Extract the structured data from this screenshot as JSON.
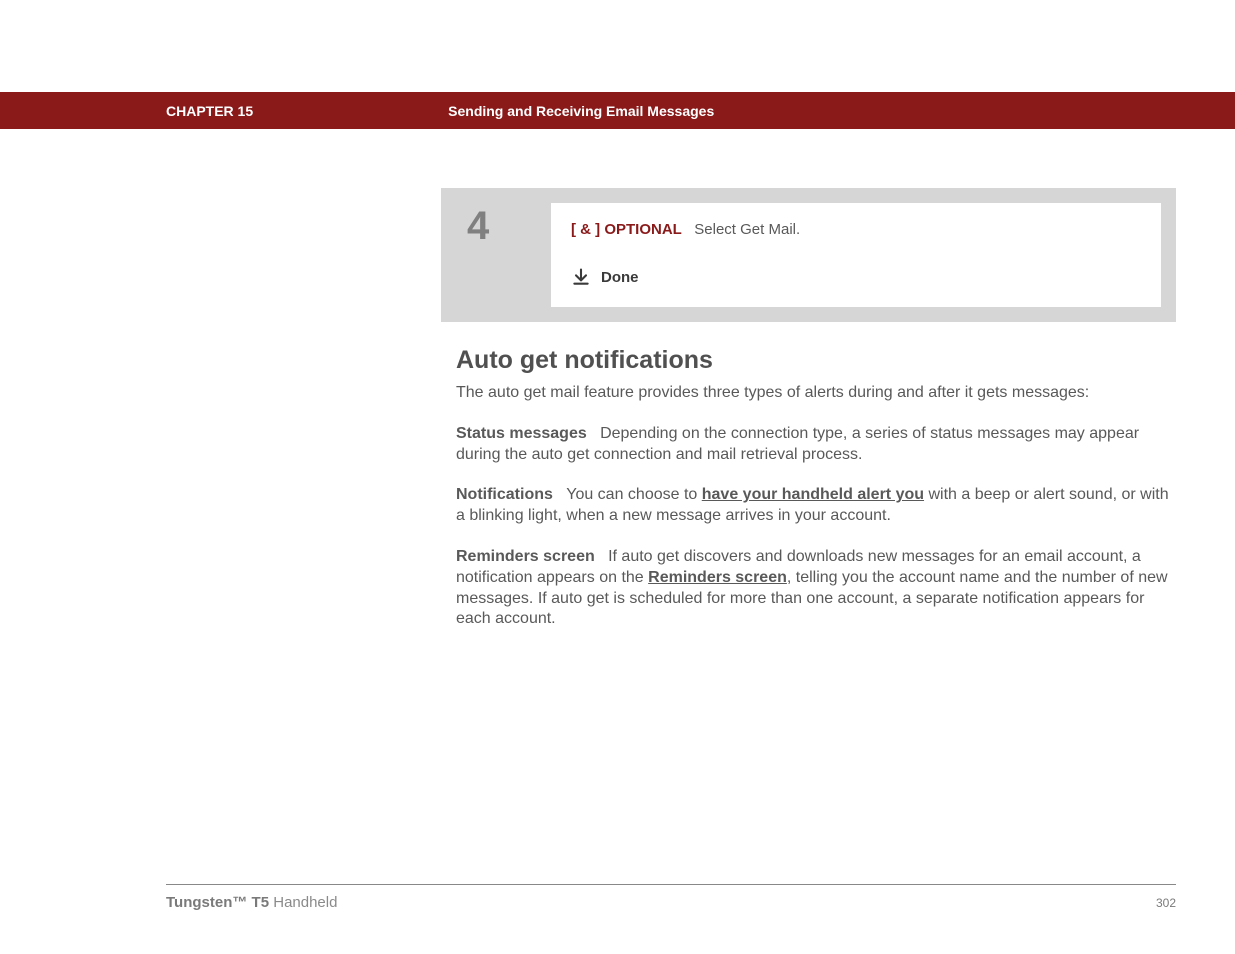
{
  "header": {
    "chapter": "CHAPTER 15",
    "title": "Sending and Receiving Email Messages"
  },
  "step": {
    "number": "4",
    "optional_prefix": "[ & ]  OPTIONAL",
    "optional_text": "Select Get Mail.",
    "done_label": "Done"
  },
  "section": {
    "heading": "Auto get notifications",
    "intro": "The auto get mail feature provides three types of alerts during and after it gets messages:",
    "status_label": "Status messages",
    "status_text": "Depending on the connection type, a series of status messages may appear during the auto get connection and mail retrieval process.",
    "notif_label": "Notifications",
    "notif_text_a": "You can choose to ",
    "notif_link": "have your handheld alert you",
    "notif_text_b": " with a beep or alert sound, or with a blinking light, when a new message arrives in your account.",
    "rem_label": "Reminders screen",
    "rem_text_a": "If auto get discovers and downloads new messages for an email account, a notification appears on the ",
    "rem_link": "Reminders screen",
    "rem_text_b": ", telling you the account name and the number of new messages. If auto get is scheduled for more than one account, a separate notification appears for each account."
  },
  "footer": {
    "product_bold": "Tungsten™ T5",
    "product_rest": " Handheld",
    "page": "302"
  }
}
